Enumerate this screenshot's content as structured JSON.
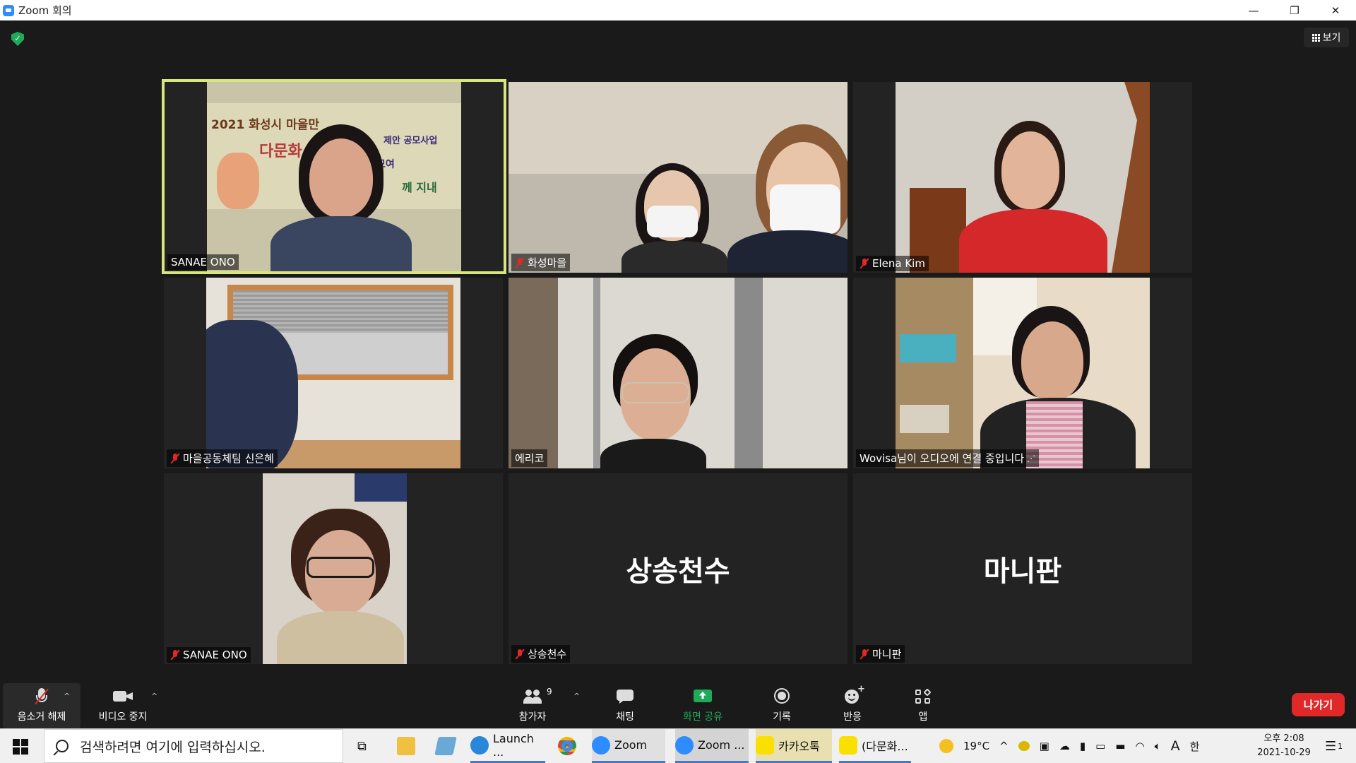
{
  "window": {
    "title": "Zoom 회의",
    "minimize": "—",
    "restore": "❐",
    "close": "✕"
  },
  "view_button": {
    "label": "보기"
  },
  "security_icon": "shield-check-icon",
  "participants": [
    {
      "name": "SANAE ONO",
      "muted": false,
      "active_speaker": true,
      "video": true
    },
    {
      "name": "화성마을",
      "muted": true,
      "video": true
    },
    {
      "name": "Elena Kim",
      "muted": true,
      "video": true
    },
    {
      "name": "마을공동체팀 신은혜",
      "muted": true,
      "video": true
    },
    {
      "name": "에리코",
      "muted": false,
      "video": true
    },
    {
      "name": "Wovisa님이 오디오에 연결 중입니다",
      "muted": false,
      "video": true
    },
    {
      "name": "SANAE ONO",
      "muted": true,
      "video": true
    },
    {
      "name": "상송천수",
      "muted": true,
      "video": false,
      "display_name": "상송천수"
    },
    {
      "name": "마니판",
      "muted": true,
      "video": false,
      "display_name": "마니판"
    }
  ],
  "banner_text": {
    "line1": "2021 화성시 마을만",
    "line1b": "제안 공모사업",
    "line2": "다문화",
    "line2b": "모여",
    "line3": "께 지내"
  },
  "toolbar": {
    "unmute": "음소거 해제",
    "stop_video": "비디오 중지",
    "participants": "참가자",
    "participants_count": "9",
    "chat": "채팅",
    "share_screen": "화면 공유",
    "record": "기록",
    "reactions": "반응",
    "apps": "앱",
    "leave": "나가기"
  },
  "taskbar": {
    "search_placeholder": "검색하려면 여기에 입력하십시오.",
    "items": [
      {
        "label": "Launch ..."
      },
      {
        "label": "Zoom"
      },
      {
        "label": "Zoom ..."
      },
      {
        "label": "카카오톡"
      },
      {
        "label": "(다문화..."
      }
    ],
    "weather": "19°C",
    "ime_a": "A",
    "ime_han": "한",
    "clock_time": "오후 2:08",
    "clock_date": "2021-10-29",
    "notification_count": "1"
  },
  "colors": {
    "active_speaker_border": "#d9e67b",
    "share_green": "#1faa59",
    "leave_red": "#e02828",
    "muted_red": "#e02828"
  }
}
